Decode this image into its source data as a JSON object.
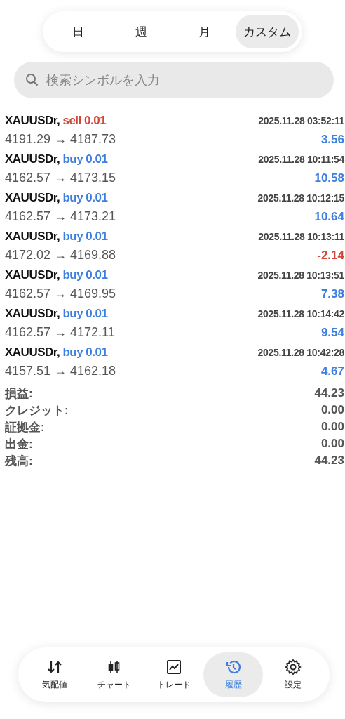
{
  "period_tabs": [
    {
      "label": "日",
      "selected": false
    },
    {
      "label": "週",
      "selected": false
    },
    {
      "label": "月",
      "selected": false
    },
    {
      "label": "カスタム",
      "selected": true
    }
  ],
  "search": {
    "placeholder": "検索シンボルを入力"
  },
  "trades": [
    {
      "symbol": "XAUUSDr,",
      "order": "sell 0.01",
      "kind": "sell",
      "time": "2025.11.28 03:52:11",
      "prices": "4191.29 → 4187.73",
      "profit": "3.56",
      "color": "#3d7fe0"
    },
    {
      "symbol": "XAUUSDr,",
      "order": "buy 0.01",
      "kind": "buy",
      "time": "2025.11.28 10:11:54",
      "prices": "4162.57 → 4173.15",
      "profit": "10.58",
      "color": "#3d7fe0"
    },
    {
      "symbol": "XAUUSDr,",
      "order": "buy 0.01",
      "kind": "buy",
      "time": "2025.11.28 10:12:15",
      "prices": "4162.57 → 4173.21",
      "profit": "10.64",
      "color": "#3d7fe0"
    },
    {
      "symbol": "XAUUSDr,",
      "order": "buy 0.01",
      "kind": "buy",
      "time": "2025.11.28 10:13:11",
      "prices": "4172.02 → 4169.88",
      "profit": "-2.14",
      "color": "#d0463a"
    },
    {
      "symbol": "XAUUSDr,",
      "order": "buy 0.01",
      "kind": "buy",
      "time": "2025.11.28 10:13:51",
      "prices": "4162.57 → 4169.95",
      "profit": "7.38",
      "color": "#3d7fe0"
    },
    {
      "symbol": "XAUUSDr,",
      "order": "buy 0.01",
      "kind": "buy",
      "time": "2025.11.28 10:14:42",
      "prices": "4162.57 → 4172.11",
      "profit": "9.54",
      "color": "#3d7fe0"
    },
    {
      "symbol": "XAUUSDr,",
      "order": "buy 0.01",
      "kind": "buy",
      "time": "2025.11.28 10:42:28",
      "prices": "4157.51 → 4162.18",
      "profit": "4.67",
      "color": "#3d7fe0"
    }
  ],
  "summary": [
    {
      "label": "損益:",
      "value": "44.23"
    },
    {
      "label": "クレジット:",
      "value": "0.00"
    },
    {
      "label": "証拠金:",
      "value": "0.00"
    },
    {
      "label": "出金:",
      "value": "0.00"
    },
    {
      "label": "残高:",
      "value": "44.23"
    }
  ],
  "nav": [
    {
      "label": "気配値",
      "kind": "quotes",
      "selected": false
    },
    {
      "label": "チャート",
      "kind": "chart",
      "selected": false
    },
    {
      "label": "トレード",
      "kind": "trade",
      "selected": false
    },
    {
      "label": "履歴",
      "kind": "history",
      "selected": true
    },
    {
      "label": "設定",
      "kind": "settings",
      "selected": false
    }
  ]
}
